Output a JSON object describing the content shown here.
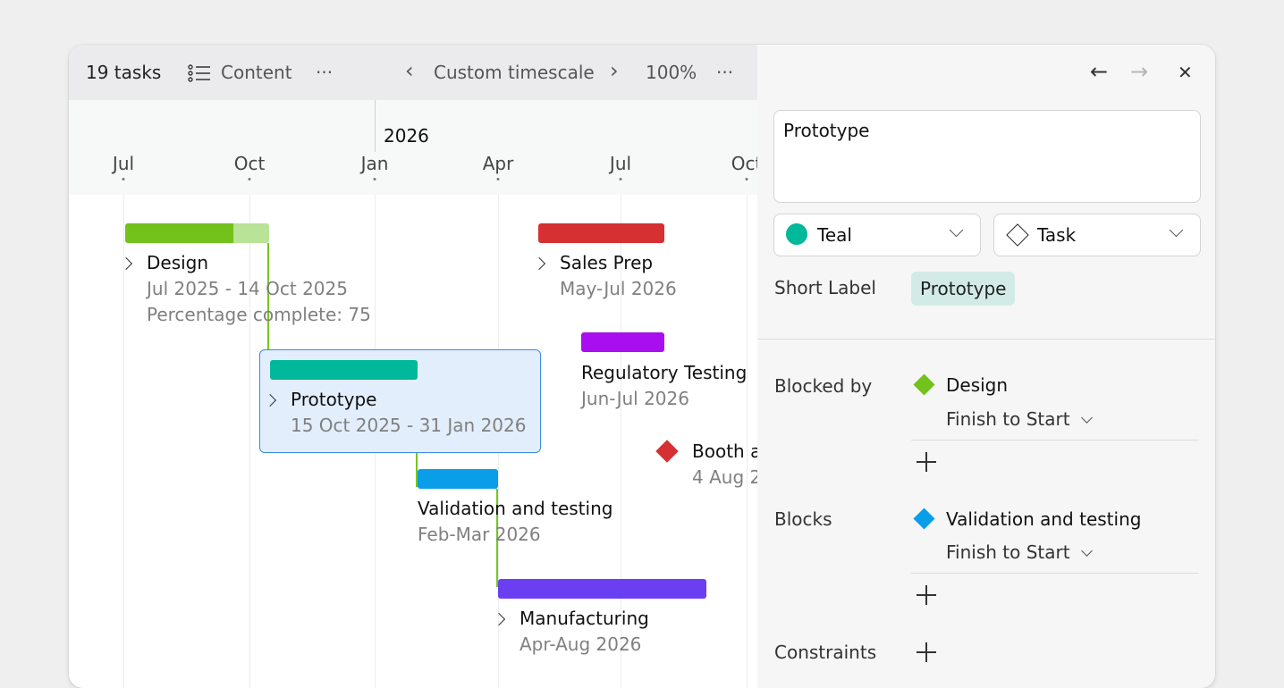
{
  "toolbar": {
    "task_count": "19 tasks",
    "content_label": "Content",
    "more_label": "···",
    "prev_label": "‹",
    "timescale_label": "Custom timescale",
    "next_label": "›",
    "zoom": "100%",
    "zoom_more": "···"
  },
  "timeline": {
    "year": "2026",
    "months": [
      "Jul",
      "Oct",
      "Jan",
      "Apr",
      "Jul",
      "Oct"
    ]
  },
  "tasks": [
    {
      "name": "Design",
      "dates": "Jul 2025 - 14 Oct 2025",
      "percent_text": "Percentage complete: 75",
      "percent_complete": 75,
      "color": "#72c21b"
    },
    {
      "name": "Sales Prep",
      "dates": "May-Jul 2026",
      "color": "#d63032"
    },
    {
      "name": "Regulatory Testing",
      "dates": "Jun-Jul 2026",
      "color": "#a90ef0"
    },
    {
      "name": "Prototype",
      "dates": "15 Oct 2025 - 31 Jan 2026",
      "color": "#00b89a"
    },
    {
      "name": "Booth a",
      "dates": "4 Aug 2",
      "color": "#d63032"
    },
    {
      "name": "Validation and testing",
      "dates": "Feb-Mar 2026",
      "color": "#0a9ee8"
    },
    {
      "name": "Manufacturing",
      "dates": "Apr-Aug 2026",
      "color": "#6a3ff2"
    }
  ],
  "panel": {
    "back_icon": "←",
    "forward_icon": "→",
    "close_icon": "✕",
    "title_value": "Prototype",
    "color_select": {
      "label": "Teal",
      "color": "#00b89a"
    },
    "type_select": {
      "label": "Task"
    },
    "short_label_title": "Short Label",
    "short_label_value": "Prototype",
    "blocked_by_title": "Blocked by",
    "blocked_by": {
      "name": "Design",
      "type": "Finish to Start",
      "color": "#72c21b"
    },
    "blocks_title": "Blocks",
    "blocks": {
      "name": "Validation and testing",
      "type": "Finish to Start",
      "color": "#0a9ee8"
    },
    "constraints_title": "Constraints"
  }
}
